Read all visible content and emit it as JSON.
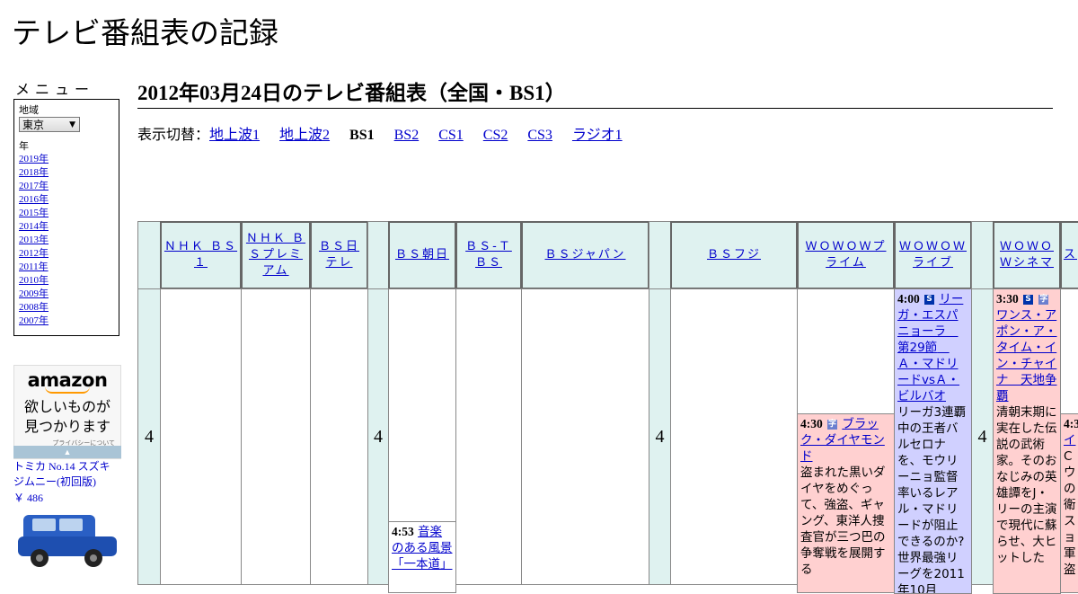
{
  "site": {
    "title": "テレビ番組表の記録"
  },
  "menu": {
    "label": "メニュー",
    "region_label": "地域",
    "region_value": "東京",
    "year_label": "年",
    "years": [
      "2019年",
      "2018年",
      "2017年",
      "2016年",
      "2015年",
      "2014年",
      "2013年",
      "2012年",
      "2011年",
      "2010年",
      "2009年",
      "2008年",
      "2007年"
    ]
  },
  "ad": {
    "brand": "amazon",
    "message_line1": "欲しいものが",
    "message_line2": "見つかります",
    "privacy": "プライバシーについて",
    "product_name": "トミカ No.14 スズキ ジムニー(初回版)",
    "product_price": "￥ 486"
  },
  "page": {
    "heading": "2012年03月24日のテレビ番組表（全国・BS1）",
    "switcher_label": "表示切替：",
    "switcher": [
      {
        "label": "地上波1",
        "current": false
      },
      {
        "label": "地上波2",
        "current": false
      },
      {
        "label": "BS1",
        "current": true
      },
      {
        "label": "BS2",
        "current": false
      },
      {
        "label": "CS1",
        "current": false
      },
      {
        "label": "CS2",
        "current": false
      },
      {
        "label": "CS3",
        "current": false
      },
      {
        "label": "ラジオ1",
        "current": false
      }
    ]
  },
  "grid": {
    "hour": "4",
    "channels": [
      "ＮＨＫ ＢＳ１",
      "ＮＨＫ ＢＳプレミアム",
      "ＢＳ日テレ",
      "ＢＳ朝日",
      "ＢＳ-ＴＢＳ",
      "ＢＳジャパン",
      "ＢＳフジ",
      "ＷＯＷＯＷプライム",
      "ＷＯＷＯＷライブ",
      "ＷＯＷＯＷシネマ",
      "ス"
    ],
    "programs": [
      {
        "time": "4:53",
        "title": "音楽のある風景「一本道」",
        "desc": "",
        "color": "#ffffff"
      },
      {
        "time": "4:30",
        "title": "ブラック・ダイヤモンド",
        "desc": "盗まれた黒いダイヤをめぐって、強盗、ギャング、東洋人捜査官が三つ巴の争奪戦を展開する",
        "color": "#ffd0d0",
        "badge": "字"
      },
      {
        "time": "4:00",
        "title": "リーガ・エスパニョーラ　第29節　Ａ・マドリードvsＡ・ビルバオ",
        "desc": "リーガ3連覇中の王者バルセロナを、モウリーニョ監督率いるレアル・マドリードが阻止できるのか?世界最強リーグを2011年10月",
        "color": "#d0d0ff",
        "badge": "S"
      },
      {
        "time": "3:30",
        "title": "ワンス・アポン・ア・タイム・イン・チャイナ　天地争覇",
        "desc": "清朝末期に実在した伝説の武術家。そのおなじみの英雄譚をJ・リーの主演で現代に蘇らせ、大ヒットした",
        "color": "#ffd0d0",
        "badge": "S"
      },
      {
        "time": "4:3",
        "title": "イ",
        "desc": "Cウの衛スョ軍盗",
        "color": "#ffd0d0"
      }
    ]
  }
}
